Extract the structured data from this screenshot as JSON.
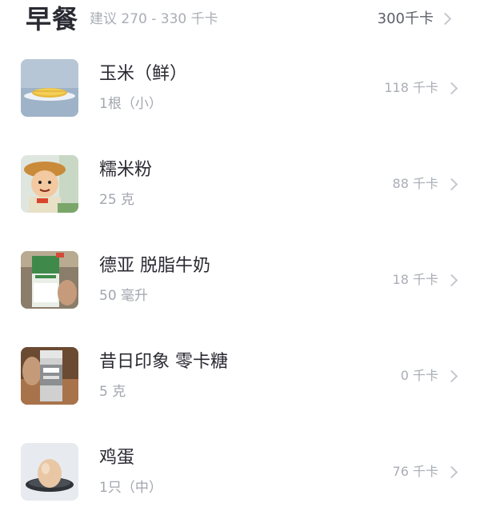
{
  "meal": {
    "title": "早餐",
    "suggestion": "建议 270 - 330 千卡",
    "total": "300千卡",
    "chevron_icon": "chevron-right-icon"
  },
  "foods": [
    {
      "name": "玉米（鲜）",
      "amount": "1根（小）",
      "kcal": "118 千卡",
      "thumb": "corn-photo"
    },
    {
      "name": "糯米粉",
      "amount": "25 克",
      "kcal": "88 千卡",
      "thumb": "rice-flour-package-photo"
    },
    {
      "name": "德亚 脱脂牛奶",
      "amount": "50 毫升",
      "kcal": "18 千卡",
      "thumb": "milk-carton-photo"
    },
    {
      "name": "昔日印象 零卡糖",
      "amount": "5 克",
      "kcal": "0 千卡",
      "thumb": "zero-sugar-bottle-photo"
    },
    {
      "name": "鸡蛋",
      "amount": "1只（中）",
      "kcal": "76 千卡",
      "thumb": "egg-photo"
    }
  ]
}
